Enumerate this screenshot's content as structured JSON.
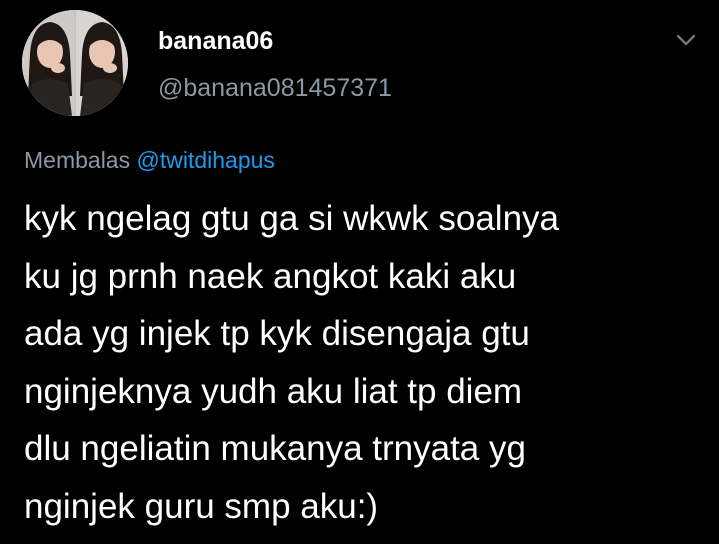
{
  "author": {
    "display_name": "banana06",
    "handle": "@banana081457371"
  },
  "reply": {
    "prefix": "Membalas",
    "mention": "@twitdihapus"
  },
  "tweet": {
    "lines": [
      "kyk ngelag gtu ga si wkwk soalnya",
      "ku jg prnh naek angkot kaki aku",
      "ada yg injek tp kyk disengaja gtu",
      "nginjeknya yudh aku liat tp diem",
      "dlu ngeliatin mukanya trnyata yg",
      "nginjek guru smp aku:)"
    ]
  },
  "icons": {
    "avatar": "profile-photo",
    "menu": "chevron-down-icon"
  },
  "colors": {
    "background": "#000000",
    "primary_text": "#ffffff",
    "secondary_text": "#8b98a5",
    "mention": "#1d9bf0"
  }
}
